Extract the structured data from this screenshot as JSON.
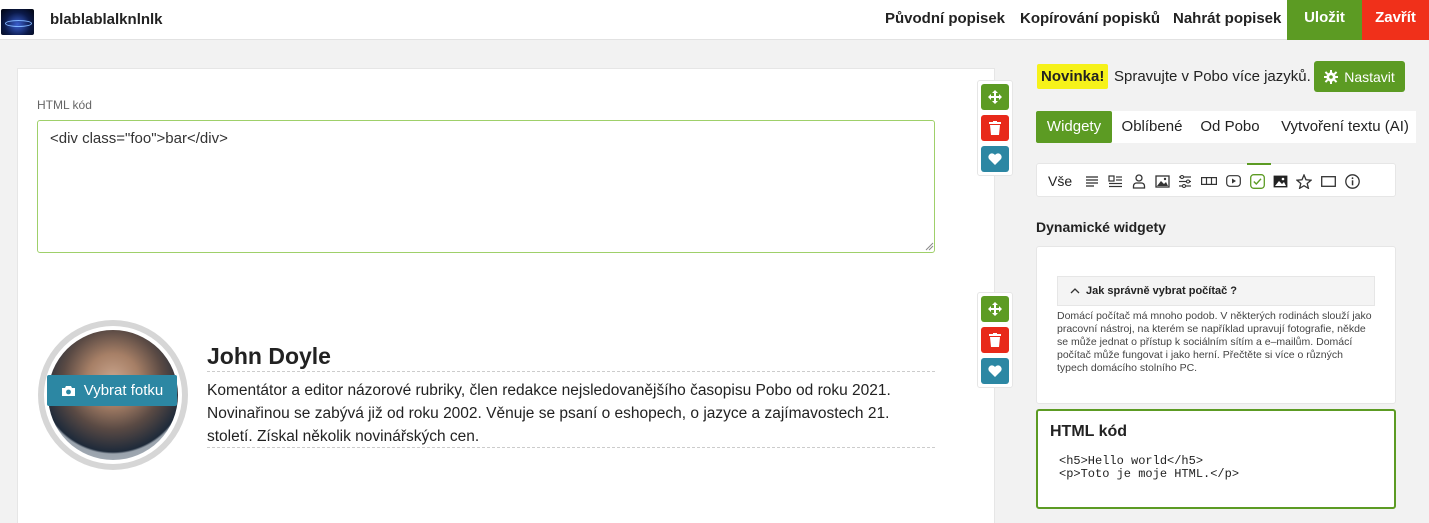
{
  "header": {
    "doc_title": "blablablalknlnlk",
    "links": [
      "Původní popisek",
      "Kopírování popisků",
      "Nahrát popisek"
    ],
    "save_label": "Uložit",
    "close_label": "Zavřít"
  },
  "editor": {
    "html_label": "HTML kód",
    "html_value": "<div class=\"foo\">bar</div>"
  },
  "profile": {
    "name": "John Doyle",
    "bio": "Komentátor a editor názorové rubriky, člen redakce nejsledovanějšího časopisu Pobo od roku 2021. Novinařinou se zabývá již od roku 2002. Věnuje se psaní o eshopech, o jazyce a zajímavostech 21. století. Získal několik novinářských cen.",
    "photo_button": "Vybrat fotku"
  },
  "sidebar": {
    "news_badge": "Novinka!",
    "news_text": "Spravujte v Pobo více jazyků.",
    "settings_button": "Nastavit",
    "tabs": [
      {
        "label": "Widgety",
        "active": true
      },
      {
        "label": "Oblíbené",
        "active": false
      },
      {
        "label": "Od Pobo",
        "active": false
      },
      {
        "label": "Vytvoření textu (AI)",
        "active": false
      }
    ],
    "filter_all": "Vše",
    "filter_icons": [
      "text-icon",
      "text-image-icon",
      "person-icon",
      "image-icon",
      "sliders-icon",
      "gallery-strip-icon",
      "video-icon",
      "checkbox-icon",
      "photo-icon",
      "star-icon",
      "box-icon",
      "info-icon"
    ],
    "active_filter": "checkbox-icon",
    "dynamic_title": "Dynamické widgety",
    "accordion_title": "Jak správně vybrat počítač ?",
    "accordion_text": "Domácí počítač má mnoho podob. V některých rodinách slouží jako pracovní nástroj, na kterém se například upravují fotografie, někde se může jednat o přístup k sociálním sítím a e–mailům. Domácí počítač může fungovat i jako herní.  Přečtěte si více o různých typech domácího stolního PC.",
    "html_card_title": "HTML kód",
    "html_card_code": "<h5>Hello world</h5>\n<p>Toto je moje HTML.</p>"
  },
  "colors": {
    "accent_green": "#5c9b23",
    "close_red": "#f0301a",
    "teal": "#2c87a3",
    "badge_yellow": "#f6f21a"
  }
}
